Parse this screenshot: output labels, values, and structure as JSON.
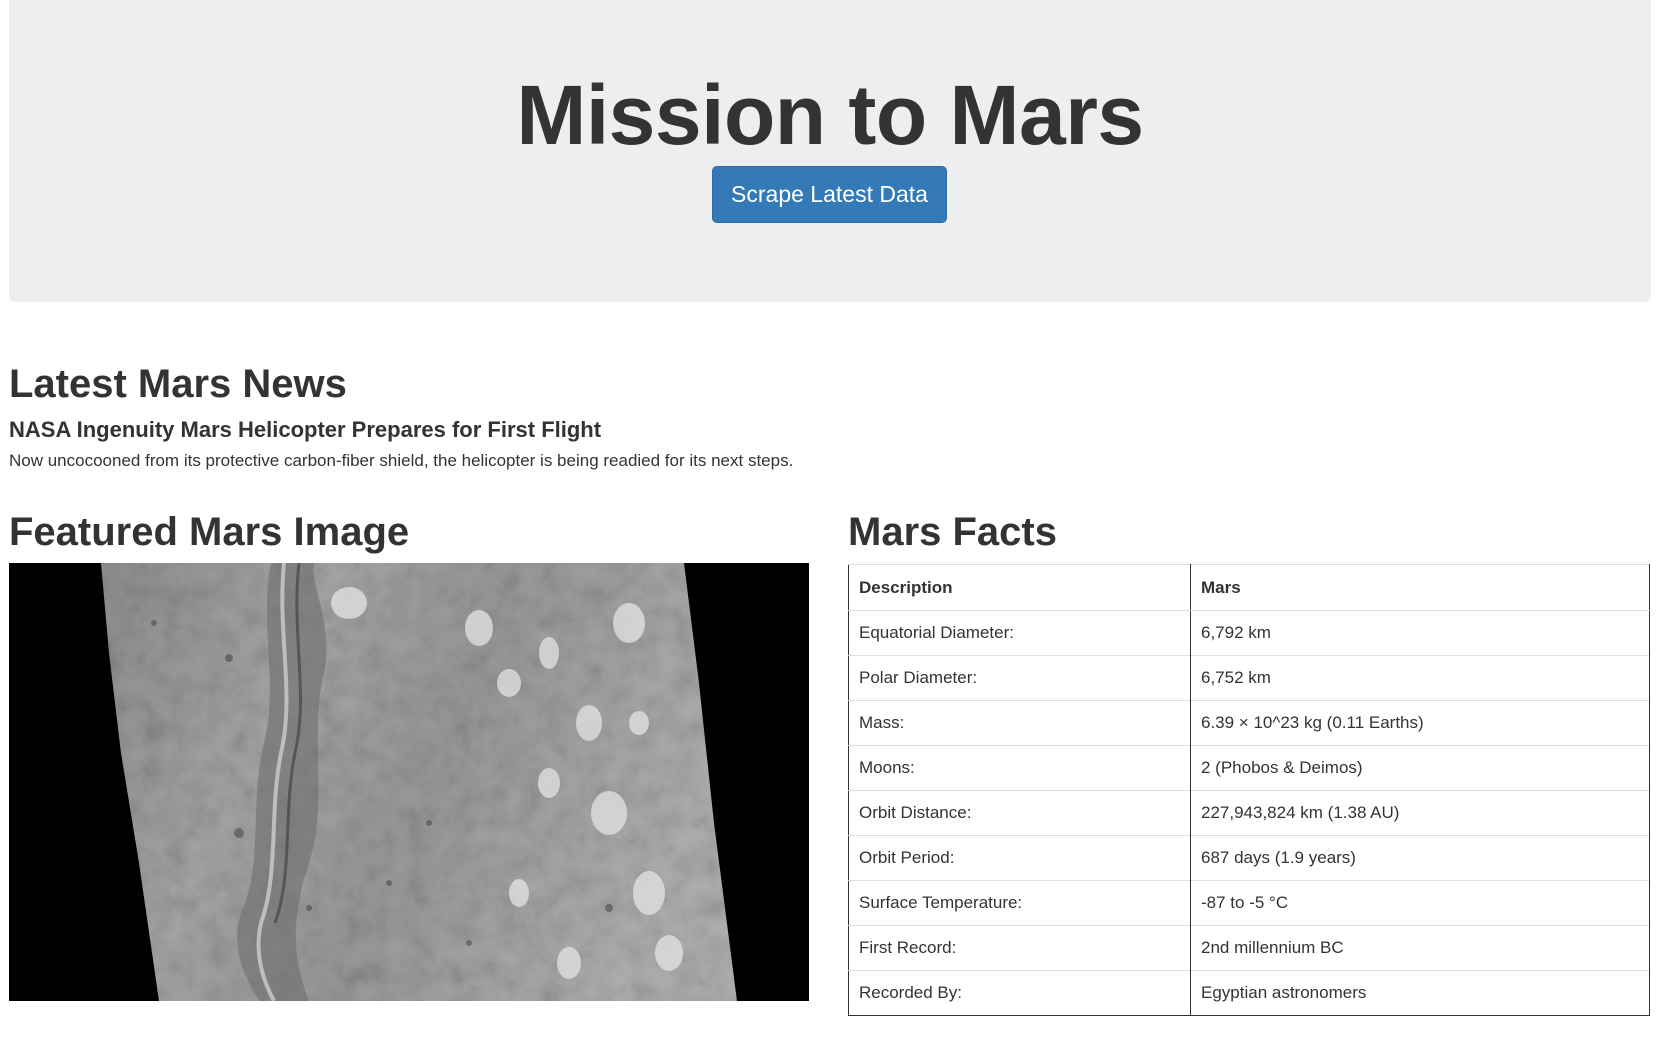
{
  "header": {
    "title": "Mission to Mars",
    "scrape_button_label": "Scrape Latest Data"
  },
  "news": {
    "heading": "Latest Mars News",
    "title": "NASA Ingenuity Mars Helicopter Prepares for First Flight",
    "teaser": "Now uncocooned from its protective carbon-fiber shield, the helicopter is being readied for its next steps."
  },
  "featured_image": {
    "heading": "Featured Mars Image"
  },
  "facts": {
    "heading": "Mars Facts",
    "columns": [
      "Description",
      "Mars"
    ],
    "rows": [
      [
        "Equatorial Diameter:",
        "6,792 km"
      ],
      [
        "Polar Diameter:",
        "6,752 km"
      ],
      [
        "Mass:",
        "6.39 × 10^23 kg (0.11 Earths)"
      ],
      [
        "Moons:",
        "2 (Phobos & Deimos)"
      ],
      [
        "Orbit Distance:",
        "227,943,824 km (1.38 AU)"
      ],
      [
        "Orbit Period:",
        "687 days (1.9 years)"
      ],
      [
        "Surface Temperature:",
        "-87 to -5 °C"
      ],
      [
        "First Record:",
        "2nd millennium BC"
      ],
      [
        "Recorded By:",
        "Egyptian astronomers"
      ]
    ]
  },
  "colors": {
    "jumbotron_bg": "#eeeeee",
    "button_primary": "#337ab7",
    "text": "#333333"
  }
}
